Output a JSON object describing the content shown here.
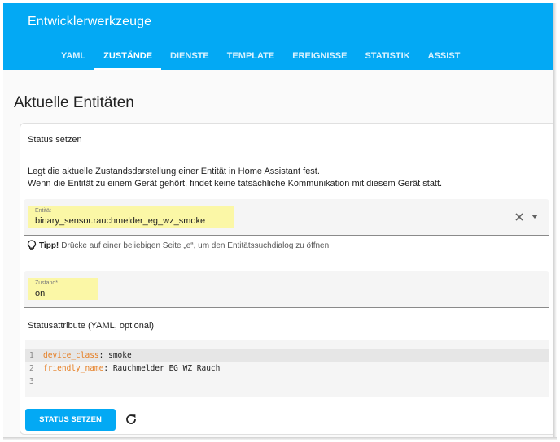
{
  "header": {
    "title": "Entwicklerwerkzeuge",
    "tabs": [
      {
        "label": "YAML",
        "active": false
      },
      {
        "label": "ZUSTÄNDE",
        "active": true
      },
      {
        "label": "DIENSTE",
        "active": false
      },
      {
        "label": "TEMPLATE",
        "active": false
      },
      {
        "label": "EREIGNISSE",
        "active": false
      },
      {
        "label": "STATISTIK",
        "active": false
      },
      {
        "label": "ASSIST",
        "active": false
      }
    ]
  },
  "page": {
    "heading": "Aktuelle Entitäten"
  },
  "set_state": {
    "title": "Status setzen",
    "description_line1": "Legt die aktuelle Zustandsdarstellung einer Entität in Home Assistant fest.",
    "description_line2": "Wenn die Entität zu einem Gerät gehört, findet keine tatsächliche Kommunikation mit diesem Gerät statt.",
    "entity": {
      "label": "Entität",
      "value": "binary_sensor.rauchmelder_eg_wz_smoke"
    },
    "tip": {
      "label": "Tipp!",
      "text": "Drücke auf einer beliebigen Seite „e“, um den Entitätssuchdialog zu öffnen."
    },
    "state": {
      "label": "Zustand*",
      "value": "on"
    },
    "attributes_label": "Statusattribute (YAML, optional)",
    "code_lines": [
      {
        "no": "1",
        "key": "device_class",
        "sep": ": ",
        "value": "smoke"
      },
      {
        "no": "2",
        "key": "friendly_name",
        "sep": ": ",
        "value": "Rauchmelder EG WZ Rauch"
      },
      {
        "no": "3",
        "key": "",
        "sep": "",
        "value": ""
      }
    ],
    "submit_label": "STATUS SETZEN"
  },
  "icons": {
    "clear": "close-icon",
    "dropdown": "chevron-down-icon",
    "tip": "lightbulb-icon",
    "refresh": "refresh-icon"
  },
  "colors": {
    "primary": "#03a9f4",
    "highlight": "#fbf7a6",
    "yaml_key": "#e67e22"
  }
}
